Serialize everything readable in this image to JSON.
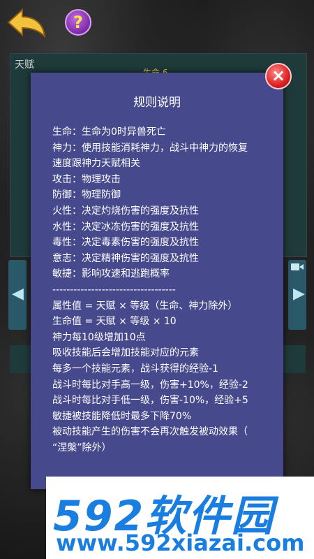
{
  "header": {
    "help_label": "?"
  },
  "talent_panel": {
    "label": "天赋",
    "sub_label": "生命 6"
  },
  "dialog": {
    "title": "规则说明",
    "close_label": "×",
    "rules": [
      "生命：生命为0时异兽死亡",
      "神力：使用技能消耗神力，战斗中神力的恢复",
      "速度跟神力天赋相关",
      "攻击：物理攻击",
      "防御：物理防御",
      "火性：决定灼烧伤害的强度及抗性",
      "水性：决定冰冻伤害的强度及抗性",
      "毒性：决定毒素伤害的强度及抗性",
      "意志：决定精神伤害的强度及抗性",
      "敏捷：影响攻速和逃跑概率",
      "-----------------------------------",
      "属性值 = 天赋 × 等级（生命、神力除外）",
      "生命值 = 天赋 × 等级 × 10",
      "神力每10级增加10点",
      "吸收技能后会增加技能对应的元素",
      "每多一个技能元素，战斗获得的经验-1",
      "战斗时每比对手高一级，伤害+10%，经验-2",
      "战斗时每比对手低一级，伤害-10%，经验+5",
      "敏捷被技能降低时最多下降70%",
      "被动技能产生的伤害不会再次触发被动效果（",
      "“涅槃”除外）"
    ]
  },
  "watermark": {
    "logo": "592软件园",
    "url": "www.592xiazai.com"
  }
}
